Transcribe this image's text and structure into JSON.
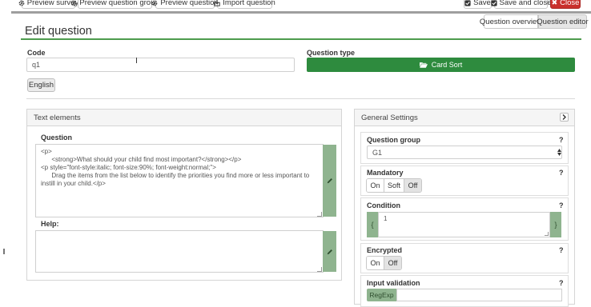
{
  "toolbar": {
    "preview_survey": "Preview survey",
    "preview_group": "Preview question group",
    "preview_question": "Preview question",
    "import_question": "Import question",
    "save": "Save",
    "save_close": "Save and close",
    "close": "Close"
  },
  "views": {
    "overview": "Question overview",
    "editor": "Question editor"
  },
  "page": {
    "title": "Edit question"
  },
  "code": {
    "label": "Code",
    "value": "q1"
  },
  "qtype": {
    "label": "Question type",
    "value": "Card Sort"
  },
  "language_tab": "English",
  "text_elements": {
    "header": "Text elements",
    "question_label": "Question",
    "question_text": "<p>\n      <strong>What should your child find most important?</strong></p>\n<p style=\"font-style:italic; font-size:90%; font-weight:normal;\">\n      Drag the items from the list below to identify the priorities you find more or less important to instill in your child.</p>",
    "help_label": "Help:",
    "help_text": ""
  },
  "settings": {
    "header": "General Settings",
    "help_mark": "?",
    "question_group": {
      "label": "Question group",
      "value": "G1"
    },
    "mandatory": {
      "label": "Mandatory",
      "options": [
        "On",
        "Soft",
        "Off"
      ]
    },
    "condition": {
      "label": "Condition",
      "value": "1",
      "left_brace": "{",
      "right_brace": "}"
    },
    "encrypted": {
      "label": "Encrypted",
      "options": [
        "On",
        "Off"
      ]
    },
    "input_validation": {
      "label": "Input validation",
      "button": "RegExp"
    }
  },
  "colors": {
    "accent_green": "#2e8b3e",
    "close_red": "#c9302c"
  }
}
